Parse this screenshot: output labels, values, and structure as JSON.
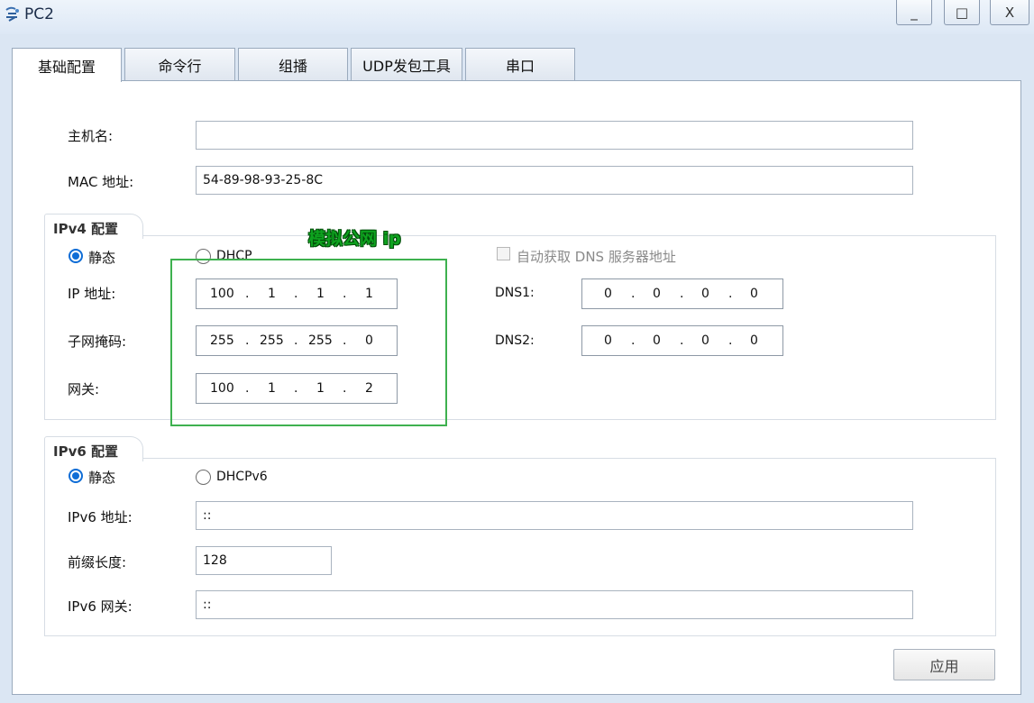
{
  "window": {
    "title": "PC2",
    "minimize": "_",
    "maximize": "□",
    "close": "X"
  },
  "tabs": [
    {
      "label": "基础配置",
      "active": true
    },
    {
      "label": "命令行"
    },
    {
      "label": "组播"
    },
    {
      "label": "UDP发包工具"
    },
    {
      "label": "串口"
    }
  ],
  "basic": {
    "hostname_label": "主机名:",
    "hostname_value": "",
    "mac_label": "MAC 地址:",
    "mac_value": "54-89-98-93-25-8C"
  },
  "ipv4": {
    "group_title": "IPv4 配置",
    "static_label": "静态",
    "dhcp_label": "DHCP",
    "auto_dns_label": "自动获取 DNS 服务器地址",
    "ip_label": "IP 地址:",
    "ip": [
      "100",
      "1",
      "1",
      "1"
    ],
    "mask_label": "子网掩码:",
    "mask": [
      "255",
      "255",
      "255",
      "0"
    ],
    "gateway_label": "网关:",
    "gateway": [
      "100",
      "1",
      "1",
      "2"
    ],
    "dns1_label": "DNS1:",
    "dns1": [
      "0",
      "0",
      "0",
      "0"
    ],
    "dns2_label": "DNS2:",
    "dns2": [
      "0",
      "0",
      "0",
      "0"
    ],
    "dot": "."
  },
  "annotation": {
    "text": "模拟公网 ip",
    "color": "#3eb14f"
  },
  "ipv6": {
    "group_title": "IPv6 配置",
    "static_label": "静态",
    "dhcp_label": "DHCPv6",
    "address_label": "IPv6 地址:",
    "address_value": "::",
    "prefix_label": "前缀长度:",
    "prefix_value": "128",
    "gateway_label": "IPv6 网关:",
    "gateway_value": "::"
  },
  "apply_button": "应用",
  "colors": {
    "accent": "#0f6dd6",
    "panel_bg": "#ffffff",
    "window_bg": "#dbe6f3"
  }
}
